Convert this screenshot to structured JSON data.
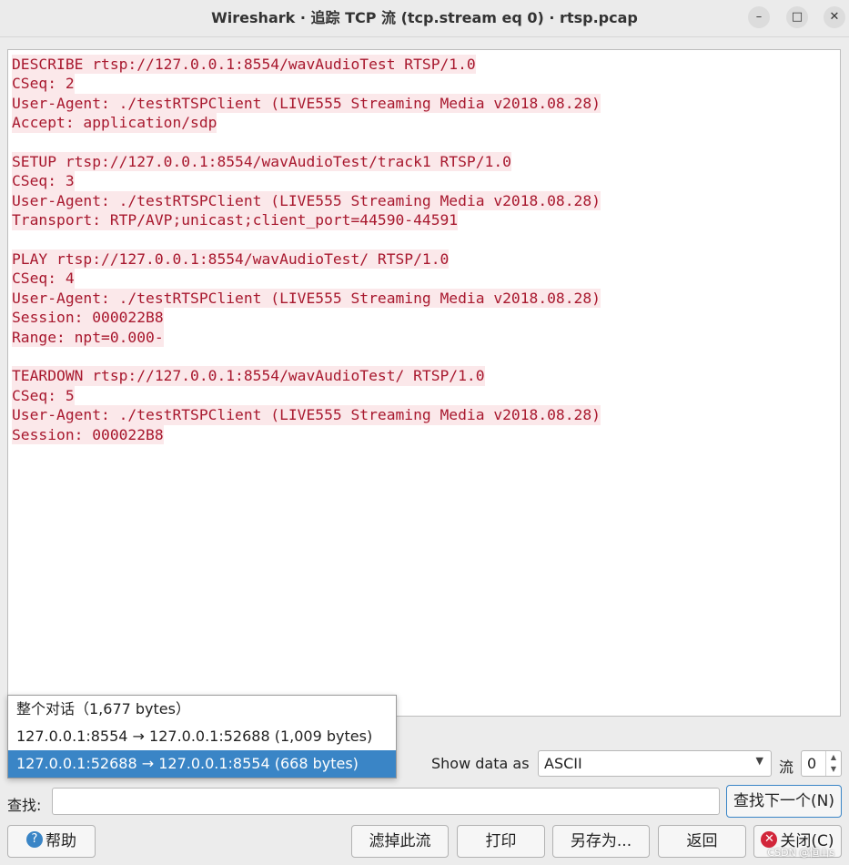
{
  "window": {
    "title": "Wireshark · 追踪 TCP 流 (tcp.stream eq 0) · rtsp.pcap",
    "minimize_icon": "minimize-icon",
    "maximize_icon": "maximize-icon",
    "close_icon": "close-icon"
  },
  "stream": {
    "blocks": [
      [
        "DESCRIBE rtsp://127.0.0.1:8554/wavAudioTest RTSP/1.0",
        "CSeq: 2",
        "User-Agent: ./testRTSPClient (LIVE555 Streaming Media v2018.08.28)",
        "Accept: application/sdp"
      ],
      [
        "SETUP rtsp://127.0.0.1:8554/wavAudioTest/track1 RTSP/1.0",
        "CSeq: 3",
        "User-Agent: ./testRTSPClient (LIVE555 Streaming Media v2018.08.28)",
        "Transport: RTP/AVP;unicast;client_port=44590-44591"
      ],
      [
        "PLAY rtsp://127.0.0.1:8554/wavAudioTest/ RTSP/1.0",
        "CSeq: 4",
        "User-Agent: ./testRTSPClient (LIVE555 Streaming Media v2018.08.28)",
        "Session: 000022B8",
        "Range: npt=0.000-"
      ],
      [
        "TEARDOWN rtsp://127.0.0.1:8554/wavAudioTest/ RTSP/1.0",
        "CSeq: 5",
        "User-Agent: ./testRTSPClient (LIVE555 Streaming Media v2018.08.28)",
        "Session: 000022B8"
      ]
    ],
    "client_text_color": "#a8182e",
    "client_bg_color": "#fbe8ea"
  },
  "conversation_dropdown": {
    "options": [
      "整个对话（1,677 bytes）",
      "127.0.0.1:8554 → 127.0.0.1:52688 (1,009 bytes)",
      "127.0.0.1:52688 → 127.0.0.1:8554 (668 bytes)"
    ],
    "selected_index": 2,
    "selected_color": "#3a85c6"
  },
  "controls": {
    "show_data_as_label": "Show data as",
    "show_data_as_value": "ASCII",
    "stream_label": "流",
    "stream_value": "0",
    "find_label": "查找:",
    "find_value": "",
    "find_next_button": "查找下一个(N)"
  },
  "buttons": {
    "help": "帮助",
    "help_icon": "help-icon",
    "filter_out": "滤掉此流",
    "print": "打印",
    "save_as": "另存为...",
    "back": "返回",
    "close": "关闭(C)",
    "close_icon": "close-circle-icon"
  },
  "watermark": "CSDN @恒山s"
}
